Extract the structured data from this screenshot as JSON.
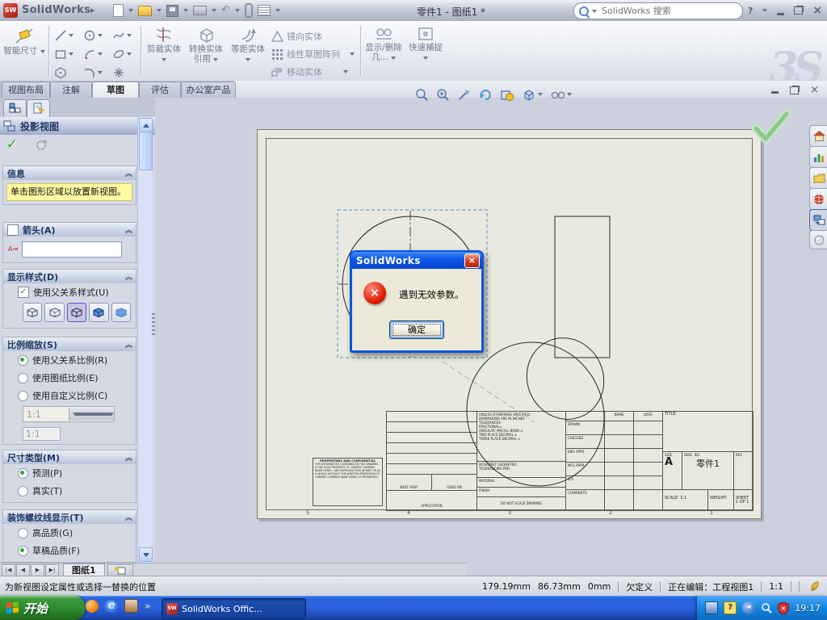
{
  "icons": {
    "close": "×",
    "help": "?",
    "chevron_right": "▸",
    "overflow": "»",
    "check": "✓",
    "collapse": "︽",
    "watermark": "3S",
    "undo": "↶",
    "question": "?",
    "e_logo": "e",
    "nav_first": "|◀",
    "nav_prev": "◀",
    "nav_next": "▶",
    "nav_last": "▶|"
  },
  "titlebar": {
    "app_name": "SolidWorks",
    "doc_title": "零件1 - 图纸1 *",
    "search_placeholder": "SolidWorks 搜索"
  },
  "ribbon": {
    "smart_dimension": "智能尺寸",
    "trim_entities": "剪裁实体",
    "convert_entities": "转换实体引用",
    "offset_entities": "等距实体",
    "mirror_entities": "镜向实体",
    "linear_pattern": "线性草图阵列",
    "move_entities": "移动实体",
    "display_delete_relations": "显示/删除几...",
    "quick_snaps": "快速捕捉"
  },
  "tabs": {
    "items": [
      "视图布局",
      "注解",
      "草图",
      "评估",
      "办公室产品"
    ],
    "active": "草图"
  },
  "property_manager": {
    "title": "投影视图",
    "info_header": "信息",
    "info_message": "单击图形区域以放置新视图。",
    "arrow_header": "箭头(A)",
    "arrow_icon_text": "A⇥",
    "arrow_input_value": "",
    "display_style_header": "显示样式(D)",
    "use_parent_style": "使用父关系样式(U)",
    "scale_header": "比例缩放(S)",
    "scale_options": [
      "使用父关系比例(R)",
      "使用图纸比例(E)",
      "使用自定义比例(C)"
    ],
    "scale_dropdown_value": "1:1",
    "scale_input_value": "1:1",
    "dim_type_header": "尺寸类型(M)",
    "dim_type_options": [
      "预测(P)",
      "真实(T)"
    ],
    "thread_display_header": "装饰螺纹线显示(T)",
    "thread_options": [
      "高品质(G)",
      "草稿品质(F)"
    ]
  },
  "dialog": {
    "title": "SolidWorks",
    "message": "遇到无效参数。",
    "ok_label": "确定"
  },
  "drawing": {
    "titleblock": {
      "tolerance_block": "UNLESS OTHERWISE SPECIFIED:\nDIMENSIONS ARE IN INCHES\nTOLERANCES:\nFRACTIONAL±\nANGULAR: MACH±  BEND ±\nTWO PLACE DECIMAL    ±\nTHREE PLACE DECIMAL  ±",
      "interpret": "INTERPRET GEOMETRIC\nTOLERANCING PER:",
      "material": "MATERIAL",
      "finish": "FINISH",
      "name_label": "NAME",
      "date_label": "DATE",
      "drawn": "DRAWN",
      "checked": "CHECKED",
      "eng_appr": "ENG APPR.",
      "mfg_appr": "MFG APPR.",
      "qa": "Q.A.",
      "comments": "COMMENTS:",
      "title_label": "TITLE:",
      "size_label": "SIZE",
      "size_value": "A",
      "dwg_label": "DWG.  NO.",
      "dwg_value": "零件1",
      "rev_label": "REV",
      "scale_label": "SCALE: 1:1",
      "weight_label": "WEIGHT:",
      "sheet_label": "SHEET 1 OF 1",
      "proprietary_title": "PROPRIETARY AND CONFIDENTIAL",
      "proprietary_text": "THE INFORMATION CONTAINED IN THIS DRAWING IS THE SOLE PROPERTY OF <INSERT COMPANY NAME HERE>. ANY REPRODUCTION IN PART OR AS A WHOLE WITHOUT THE WRITTEN PERMISSION OF <INSERT COMPANY NAME HERE> IS PROHIBITED.",
      "next_assy": "NEXT ASSY",
      "used_on": "USED ON",
      "application": "APPLICATION",
      "do_not_scale": "DO NOT SCALE DRAWING",
      "zones": [
        "5",
        "4",
        "3",
        "2",
        "1"
      ]
    }
  },
  "sheet_tabs": {
    "active": "图纸1"
  },
  "statusbar": {
    "hint": "为新视图设定属性或选择一替换的位置",
    "coord_x": "179.19mm",
    "coord_y": "86.73mm",
    "coord_z": "0mm",
    "def_state": "欠定义",
    "editing": "正在编辑：工程视图1",
    "scale": "1:1"
  },
  "taskbar": {
    "start_label": "开始",
    "active_task": "SolidWorks Offic...",
    "time": "19:17",
    "flag_colors": {
      "red": "#F25022",
      "green": "#7FBA00",
      "blue": "#00A4EF",
      "yellow": "#FFB900"
    }
  }
}
